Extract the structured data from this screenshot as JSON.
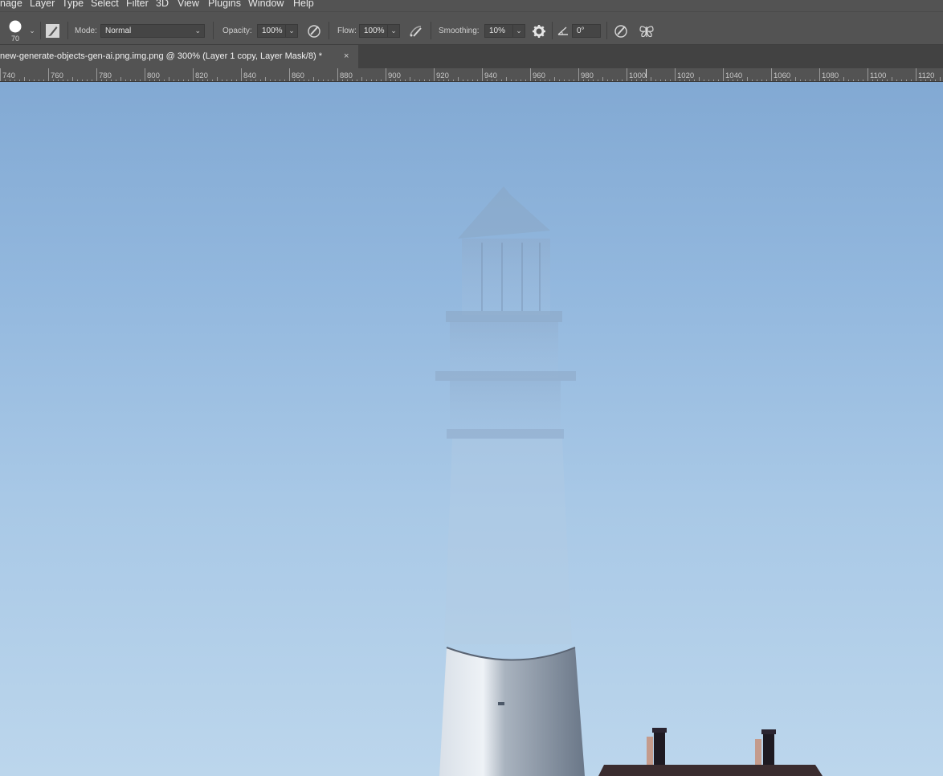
{
  "menu": [
    "nage",
    "Layer",
    "Type",
    "Select",
    "Filter",
    "3D",
    "View",
    "Plugins",
    "Window",
    "Help"
  ],
  "options": {
    "brush_size": "70",
    "mode_label": "Mode:",
    "mode_value": "Normal",
    "opacity_label": "Opacity:",
    "opacity_value": "100%",
    "flow_label": "Flow:",
    "flow_value": "100%",
    "smoothing_label": "Smoothing:",
    "smoothing_value": "10%",
    "angle_value": "0°"
  },
  "document_tab": {
    "title": "new-generate-objects-gen-ai.png.img.png @ 300% (Layer 1 copy, Layer Mask/8) *",
    "close": "×"
  },
  "ruler": {
    "labels": [
      "740",
      "760",
      "780",
      "800",
      "820",
      "840",
      "860",
      "880",
      "900",
      "920",
      "940",
      "960",
      "980",
      "1000",
      "1020",
      "1040",
      "1060",
      "1080",
      "1100",
      "1120"
    ]
  },
  "icons": {
    "brush_preset": "brush-preset-icon",
    "brush_panel": "brush-settings-panel-icon",
    "airbrush_pressure_opacity": "pressure-opacity-icon",
    "airbrush": "airbrush-icon",
    "smoothing_settings": "gear-icon",
    "angle": "angle-icon",
    "pressure_size": "pressure-size-icon",
    "symmetry": "butterfly-symmetry-icon"
  },
  "colors": {
    "ui_bg": "#535353",
    "tab_bar": "#424242",
    "sky_top": "#82a9d3",
    "sky_bottom": "#bcd6ec"
  }
}
